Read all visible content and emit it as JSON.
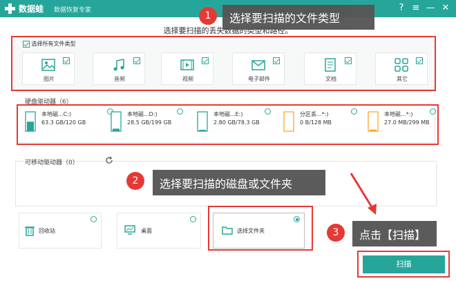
{
  "app": {
    "name": "数据蛙",
    "subtitle": "数据恢复专家"
  },
  "titlebar_icons": {
    "help": "?",
    "menu": "≡",
    "minimize": "—",
    "close": "✕"
  },
  "hint": "选择要扫描的丢失数据的类型和路径。",
  "file_types": {
    "select_all_label": "选择所有文件类型",
    "items": [
      {
        "label": "图片",
        "icon": "image-icon"
      },
      {
        "label": "音频",
        "icon": "music-icon"
      },
      {
        "label": "视频",
        "icon": "video-icon"
      },
      {
        "label": "电子邮件",
        "icon": "mail-icon"
      },
      {
        "label": "文档",
        "icon": "document-icon"
      },
      {
        "label": "其它",
        "icon": "grid-icon"
      }
    ]
  },
  "hard_drives": {
    "title": "硬盘驱动器（6）",
    "items": [
      {
        "name": "本地磁...C:)",
        "size": "63.3 GB/120 GB",
        "fill": 0.53,
        "color": "#26a69a"
      },
      {
        "name": "本地磁...D:)",
        "size": "28.5 GB/199 GB",
        "fill": 0.14,
        "color": "#26a69a"
      },
      {
        "name": "本地磁...E:)",
        "size": "2.80 GB/78.3 GB",
        "fill": 0.04,
        "color": "#26a69a"
      },
      {
        "name": "分区丢...*:)",
        "size": "0 B/128 MB",
        "fill": 0.0,
        "color": "#ffa726"
      },
      {
        "name": "本地磁...*:)",
        "size": "27.0 MB/299 MB",
        "fill": 0.09,
        "color": "#ffa726"
      }
    ]
  },
  "removable": {
    "title": "可移动驱动器（0）"
  },
  "locations": [
    {
      "label": "回收站",
      "icon": "trash-icon",
      "selected": false
    },
    {
      "label": "桌面",
      "icon": "desktop-icon",
      "selected": false
    },
    {
      "label": "选择文件夹",
      "icon": "folder-icon",
      "selected": true
    }
  ],
  "callouts": [
    {
      "number": "1",
      "text": "选择要扫描的文件类型"
    },
    {
      "number": "2",
      "text": "选择要扫描的磁盘或文件夹"
    },
    {
      "number": "3",
      "text": "点击【扫描】"
    }
  ],
  "scan_button": "扫描",
  "accent": "#26a69a",
  "highlight": "#e53935"
}
